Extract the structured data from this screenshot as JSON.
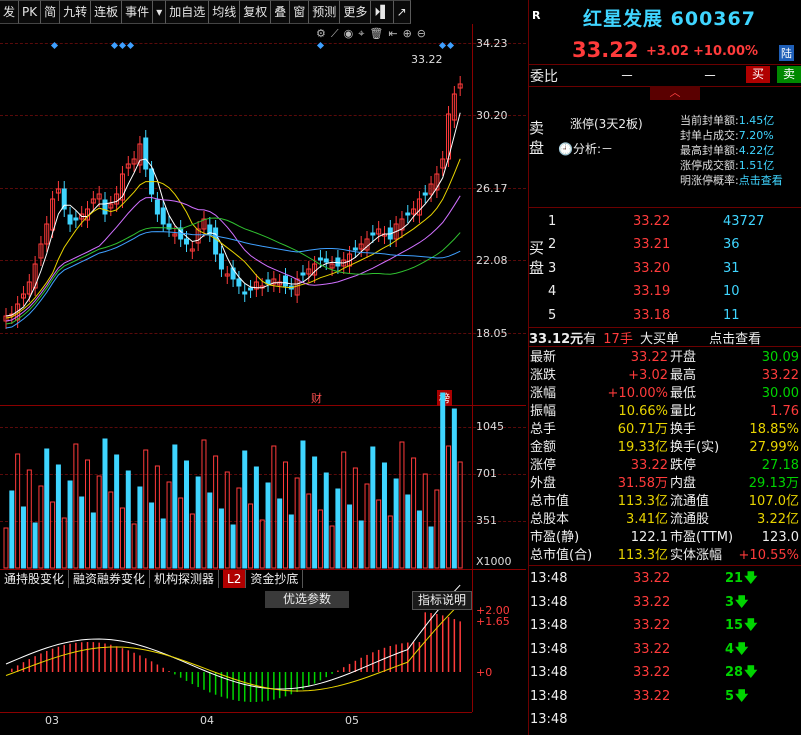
{
  "toolbar": {
    "buttons": [
      "发",
      "PK",
      "简",
      "九转",
      "连板",
      "事件",
      "▾",
      "加自选",
      "均线",
      "复权",
      "叠",
      "窗",
      "预测",
      "更多",
      "⏵▌",
      "↗"
    ]
  },
  "chart_icons": [
    "⚙",
    "⟋",
    "◉",
    "⌖",
    "🗑",
    "⇤",
    "⊕",
    "⊖"
  ],
  "price_axis": {
    "labels": [
      "34.23",
      "30.20",
      "26.17",
      "22.08",
      "18.05"
    ],
    "last_price_tag": "33.22",
    "markers": [
      "财",
      "榜"
    ]
  },
  "volume_axis": {
    "labels": [
      "1045",
      "701",
      "351"
    ],
    "unit": "X1000"
  },
  "indicator_tabs": [
    "通持股变化",
    "融资融券变化",
    "机构探测器",
    "L2",
    "资金抄底"
  ],
  "indicator_buttons": {
    "optimize": "优选参数",
    "explain": "指标说明"
  },
  "macd_axis": {
    "labels": [
      "+2.00",
      "+1.65",
      "+0"
    ]
  },
  "date_axis": {
    "labels": [
      "03",
      "04",
      "05"
    ]
  },
  "stock": {
    "badge": "R",
    "name": "红星发展",
    "code": "600367",
    "price": "33.22",
    "change": "+3.02",
    "pct": "+10.00%",
    "exchange_tag": "陆"
  },
  "weibi": {
    "label": "委比",
    "v1": "－",
    "v2": "－",
    "buy": "买",
    "sell": "卖"
  },
  "limit_up": {
    "sell_side_label": "卖盘",
    "title": "涨停(3天2板)",
    "analysis": "分析:－",
    "rows": [
      {
        "k": "当前封单额:",
        "v": "1.45亿"
      },
      {
        "k": "封单占成交:",
        "v": "7.20%"
      },
      {
        "k": "最高封单额:",
        "v": "4.22亿"
      },
      {
        "k": "涨停成交额:",
        "v": "1.51亿"
      },
      {
        "k": "明涨停概率:",
        "v": "点击查看"
      }
    ]
  },
  "buy_side": {
    "label": "买盘",
    "rows": [
      {
        "level": "1",
        "price": "33.22",
        "vol": "43727"
      },
      {
        "level": "2",
        "price": "33.21",
        "vol": "36"
      },
      {
        "level": "3",
        "price": "33.20",
        "vol": "31"
      },
      {
        "level": "4",
        "price": "33.19",
        "vol": "10"
      },
      {
        "level": "5",
        "price": "33.18",
        "vol": "11"
      }
    ]
  },
  "big_order": {
    "price": "33.12元",
    "have": "有",
    "hands": "17手",
    "text": "大买单",
    "link": "点击查看"
  },
  "quote": [
    {
      "k1": "最新",
      "v1": "33.22",
      "c1": "red",
      "k2": "开盘",
      "v2": "30.09",
      "c2": "green"
    },
    {
      "k1": "涨跌",
      "v1": "+3.02",
      "c1": "red",
      "k2": "最高",
      "v2": "33.22",
      "c2": "red"
    },
    {
      "k1": "涨幅",
      "v1": "+10.00%",
      "c1": "red",
      "k2": "最低",
      "v2": "30.00",
      "c2": "green"
    },
    {
      "k1": "振幅",
      "v1": "10.66%",
      "c1": "yellow",
      "k2": "量比",
      "v2": "1.76",
      "c2": "red"
    },
    {
      "k1": "总手",
      "v1": "60.71万",
      "c1": "yellow",
      "k2": "换手",
      "v2": "18.85%",
      "c2": "yellow"
    },
    {
      "k1": "金额",
      "v1": "19.33亿",
      "c1": "yellow",
      "k2": "换手(实)",
      "v2": "27.99%",
      "c2": "yellow"
    },
    {
      "k1": "涨停",
      "v1": "33.22",
      "c1": "red",
      "k2": "跌停",
      "v2": "27.18",
      "c2": "green"
    },
    {
      "k1": "外盘",
      "v1": "31.58万",
      "c1": "red",
      "k2": "内盘",
      "v2": "29.13万",
      "c2": "green"
    },
    {
      "k1": "总市值",
      "v1": "113.3亿",
      "c1": "yellow",
      "k2": "流通值",
      "v2": "107.0亿",
      "c2": "yellow"
    },
    {
      "k1": "总股本",
      "v1": "3.41亿",
      "c1": "yellow",
      "k2": "流通股",
      "v2": "3.22亿",
      "c2": "yellow"
    },
    {
      "k1": "市盈(静)",
      "v1": "122.1",
      "c1": "white",
      "k2": "市盈(TTM)",
      "v2": "123.0",
      "c2": "white"
    },
    {
      "k1": "总市值(合)",
      "v1": "113.3亿",
      "c1": "yellow",
      "k2": "实体涨幅",
      "v2": "+10.55%",
      "c2": "red"
    }
  ],
  "ticks": [
    {
      "time": "13:48",
      "price": "33.22",
      "vol": "21"
    },
    {
      "time": "13:48",
      "price": "33.22",
      "vol": "3"
    },
    {
      "time": "13:48",
      "price": "33.22",
      "vol": "15"
    },
    {
      "time": "13:48",
      "price": "33.22",
      "vol": "4"
    },
    {
      "time": "13:48",
      "price": "33.22",
      "vol": "28"
    },
    {
      "time": "13:48",
      "price": "33.22",
      "vol": "5"
    },
    {
      "time": "13:48",
      "price": "",
      "vol": ""
    }
  ]
}
